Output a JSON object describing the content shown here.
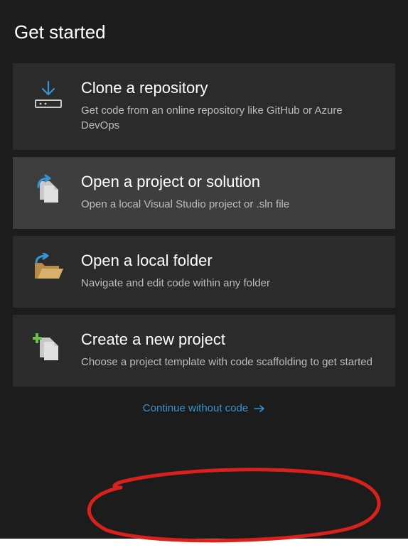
{
  "header": {
    "title": "Get started"
  },
  "cards": [
    {
      "title": "Clone a repository",
      "desc": "Get code from an online repository like GitHub or Azure DevOps"
    },
    {
      "title": "Open a project or solution",
      "desc": "Open a local Visual Studio project or .sln file"
    },
    {
      "title": "Open a local folder",
      "desc": "Navigate and edit code within any folder"
    },
    {
      "title": "Create a new project",
      "desc": "Choose a project template with code scaffolding to get started"
    }
  ],
  "continue": {
    "label": "Continue without code"
  }
}
